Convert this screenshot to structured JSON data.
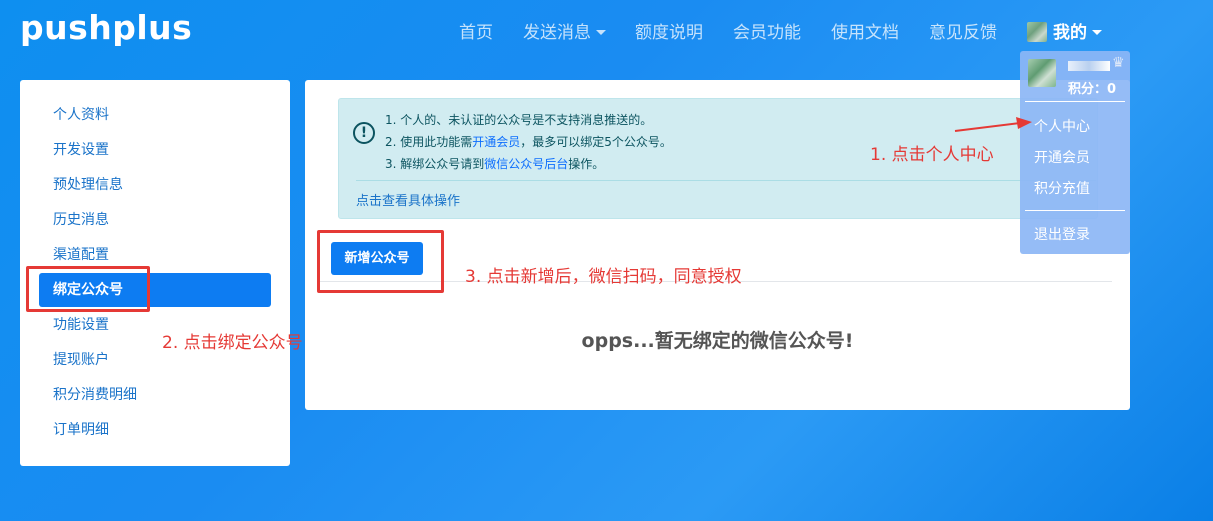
{
  "brand": "pushplus",
  "nav": {
    "items": [
      {
        "label": "首页",
        "dropdown": false
      },
      {
        "label": "发送消息",
        "dropdown": true
      },
      {
        "label": "额度说明",
        "dropdown": false
      },
      {
        "label": "会员功能",
        "dropdown": false
      },
      {
        "label": "使用文档",
        "dropdown": false
      },
      {
        "label": "意见反馈",
        "dropdown": false
      }
    ],
    "user_label": "我的"
  },
  "user_menu": {
    "points_label": "积分：0",
    "items": [
      "个人中心",
      "开通会员",
      "积分充值"
    ],
    "logout": "退出登录"
  },
  "sidebar": {
    "items": [
      {
        "label": "个人资料",
        "active": false
      },
      {
        "label": "开发设置",
        "active": false
      },
      {
        "label": "预处理信息",
        "active": false
      },
      {
        "label": "历史消息",
        "active": false
      },
      {
        "label": "渠道配置",
        "active": false
      },
      {
        "label": "绑定公众号",
        "active": true
      },
      {
        "label": "功能设置",
        "active": false
      },
      {
        "label": "提现账户",
        "active": false
      },
      {
        "label": "积分消费明细",
        "active": false
      },
      {
        "label": "订单明细",
        "active": false
      }
    ]
  },
  "notice": {
    "line1": "1. 个人的、未认证的公众号是不支持消息推送的。",
    "line2_prefix": "2. 使用此功能需",
    "line2_link": "开通会员",
    "line2_suffix": "，最多可以绑定5个公众号。",
    "line3_prefix": "3. 解绑公众号请到",
    "line3_link": "微信公众号后台",
    "line3_suffix": "操作。",
    "more_link": "点击查看具体操作"
  },
  "add_button": "新增公众号",
  "empty_message": "opps...暂无绑定的微信公众号!",
  "annotations": {
    "step1": "1. 点击个人中心",
    "step2": "2. 点击绑定公众号",
    "step3": "3. 点击新增后，微信扫码，同意授权"
  },
  "colors": {
    "primary": "#0d7cf2",
    "annotation": "#e53935",
    "alert_bg": "#d1ecf1"
  }
}
